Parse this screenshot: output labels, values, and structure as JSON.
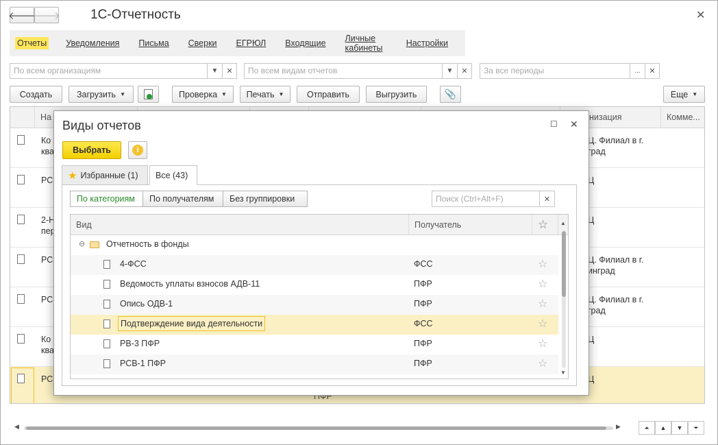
{
  "app": {
    "title": "1С-Отчетность"
  },
  "menu": [
    "Отчеты",
    "Уведомления",
    "Письма",
    "Сверки",
    "ЕГРЮЛ",
    "Входящие",
    "Личные кабинеты",
    "Настройки"
  ],
  "filters": {
    "org_placeholder": "По всем организациям",
    "type_placeholder": "По всем видам отчетов",
    "period_placeholder": "За все периоды"
  },
  "toolbar": {
    "create": "Создать",
    "load": "Загрузить",
    "check": "Проверка",
    "print": "Печать",
    "send": "Отправить",
    "export": "Выгрузить",
    "more": "Еще"
  },
  "grid": {
    "columns": [
      "Наименование",
      "",
      "",
      "",
      "",
      "Организация",
      "Комме..."
    ],
    "col_name_visible": "На",
    "col_org_visible": "низация",
    "rows": [
      {
        "name": [
          "Ко",
          "ква"
        ],
        "org": [
          "Ц. Филиал в г.",
          "град"
        ]
      },
      {
        "name": [
          "РС"
        ],
        "org": [
          "Ц"
        ]
      },
      {
        "name": [
          "2-Н",
          "пер"
        ],
        "org": [
          "Ц"
        ]
      },
      {
        "name": [
          "РС"
        ],
        "org": [
          "Ц. Филиал в г.",
          "инград"
        ]
      },
      {
        "name": [
          "РС"
        ],
        "org": [
          "Ц. Филиал в г.",
          "град"
        ]
      },
      {
        "name": [
          "Ко",
          "ква"
        ],
        "org": [
          "Ц"
        ]
      },
      {
        "name": [
          "РС"
        ],
        "org": [
          "Ц"
        ],
        "recipient": "ПФР"
      }
    ]
  },
  "modal": {
    "title": "Виды отчетов",
    "choose": "Выбрать",
    "tabs": [
      "Избранные (1)",
      "Все (43)"
    ],
    "grouping": [
      "По категориям",
      "По получателям",
      "Без группировки"
    ],
    "search_placeholder": "Поиск (Ctrl+Alt+F)",
    "columns": {
      "type": "Вид",
      "recipient": "Получатель"
    },
    "group": "Отчетность в фонды",
    "items": [
      {
        "name": "4-ФСС",
        "recipient": "ФСС"
      },
      {
        "name": "Ведомость уплаты взносов АДВ-11",
        "recipient": "ПФР"
      },
      {
        "name": "Опись ОДВ-1",
        "recipient": "ПФР"
      },
      {
        "name": "Подтверждение вида деятельности",
        "recipient": "ФСС"
      },
      {
        "name": "РВ-3 ПФР",
        "recipient": "ПФР"
      },
      {
        "name": "РСВ-1 ПФР",
        "recipient": "ПФР"
      }
    ]
  }
}
